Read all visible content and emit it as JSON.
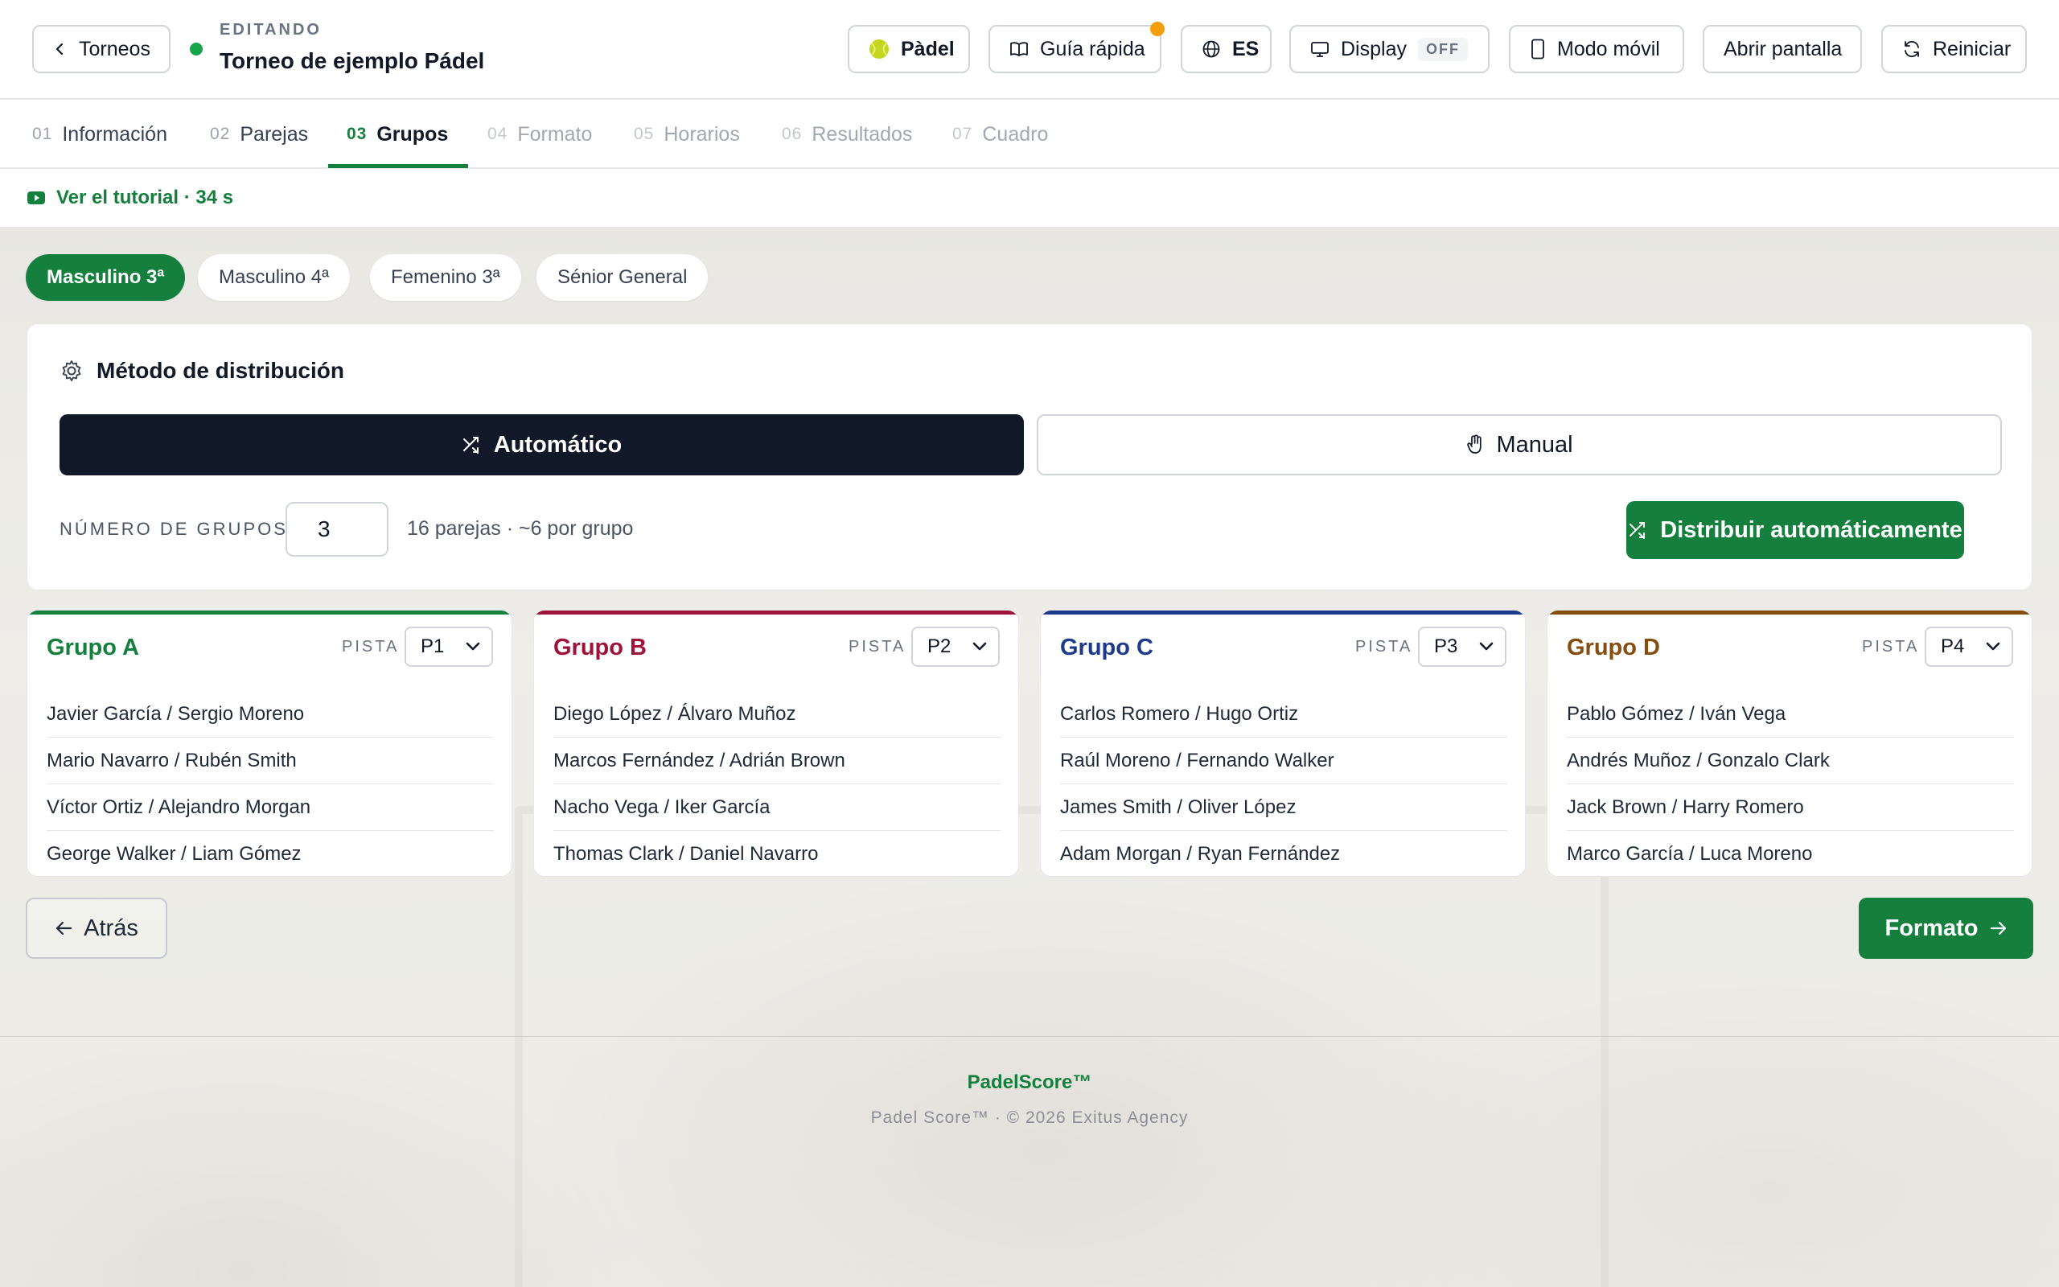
{
  "header": {
    "back_label": "Torneos",
    "edit_label": "EDITANDO",
    "title": "Torneo de ejemplo Pádel",
    "sport_label": "Pàdel",
    "guide_label": "Guía rápida",
    "lang_label": "ES",
    "display_label": "Display",
    "display_state": "OFF",
    "mobile_label": "Modo móvil",
    "open_label": "Abrir pantalla",
    "reset_label": "Reiniciar"
  },
  "steps": [
    {
      "num": "01",
      "label": "Información"
    },
    {
      "num": "02",
      "label": "Parejas"
    },
    {
      "num": "03",
      "label": "Grupos"
    },
    {
      "num": "04",
      "label": "Formato"
    },
    {
      "num": "05",
      "label": "Horarios"
    },
    {
      "num": "06",
      "label": "Resultados"
    },
    {
      "num": "07",
      "label": "Cuadro"
    }
  ],
  "tutorial": {
    "label": "Ver el tutorial · 34 s"
  },
  "categories": [
    "Masculino 3ª",
    "Masculino 4ª",
    "Femenino 3ª",
    "Sénior General"
  ],
  "method": {
    "title": "Método de distribución",
    "auto_label": "Automático",
    "manual_label": "Manual",
    "groups_label": "NÚMERO DE GRUPOS:",
    "groups_value": "3",
    "groups_info": "16 parejas · ~6 por grupo",
    "distribute_label": "Distribuir automáticamente"
  },
  "groups": [
    {
      "name": "Grupo A",
      "pista_label": "PISTA",
      "pista": "P1",
      "color": "#15803d",
      "pairs": [
        "Javier García / Sergio Moreno",
        "Mario Navarro / Rubén Smith",
        "Víctor Ortiz / Alejandro Morgan",
        "George Walker / Liam Gómez"
      ]
    },
    {
      "name": "Grupo B",
      "pista_label": "PISTA",
      "pista": "P2",
      "color": "#9f1239",
      "pairs": [
        "Diego López / Álvaro Muñoz",
        "Marcos Fernández / Adrián Brown",
        "Nacho Vega / Iker García",
        "Thomas Clark / Daniel Navarro"
      ]
    },
    {
      "name": "Grupo C",
      "pista_label": "PISTA",
      "pista": "P3",
      "color": "#1e3a8a",
      "pairs": [
        "Carlos Romero / Hugo Ortiz",
        "Raúl Moreno / Fernando Walker",
        "James Smith / Oliver López",
        "Adam Morgan / Ryan Fernández"
      ]
    },
    {
      "name": "Grupo D",
      "pista_label": "PISTA",
      "pista": "P4",
      "color": "#854d0e",
      "pairs": [
        "Pablo Gómez / Iván Vega",
        "Andrés Muñoz / Gonzalo Clark",
        "Jack Brown / Harry Romero",
        "Marco García / Luca Moreno"
      ]
    }
  ],
  "nav": {
    "back_label": "Atrás",
    "next_label": "Formato"
  },
  "footer": {
    "logo": "PadelScore™",
    "copyright": "Padel Score™ · © 2026 Exitus Agency"
  },
  "colors": {
    "accent": "#15803d",
    "dark": "#111827",
    "warning_dot": "#f59e0b"
  }
}
